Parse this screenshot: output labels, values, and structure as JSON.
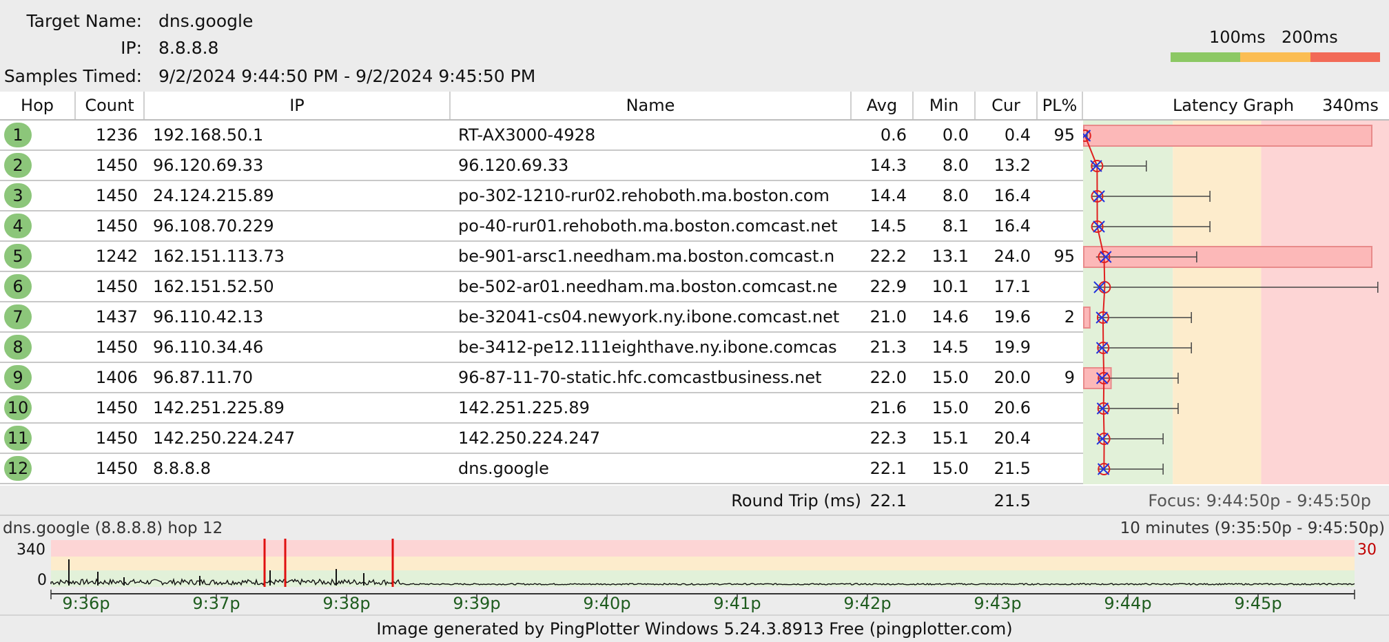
{
  "header": {
    "target_label": "Target Name:",
    "target_value": "dns.google",
    "ip_label": "IP:",
    "ip_value": "8.8.8.8",
    "samples_label": "Samples Timed:",
    "samples_value": "9/2/2024 9:44:50 PM - 9/2/2024 9:45:50 PM",
    "scale_100": "100ms",
    "scale_200": "200ms"
  },
  "colors": {
    "good": "#8cc864",
    "warn": "#fbbd53",
    "bad": "#f26a57",
    "zone_good": "#e2f1d9",
    "zone_warn": "#fdeccc",
    "zone_bad": "#fdd5d5",
    "hop_badge": "#8cc67a",
    "time_label": "#1e5c1e"
  },
  "columns": {
    "hop": "Hop",
    "count": "Count",
    "ip": "IP",
    "name": "Name",
    "avg": "Avg",
    "min": "Min",
    "cur": "Cur",
    "pl": "PL%",
    "graph": "Latency Graph",
    "graph_max": "340ms"
  },
  "hops": [
    {
      "hop": "1",
      "count": "1236",
      "ip": "192.168.50.1",
      "name": "RT-AX3000-4928",
      "avg": "0.6",
      "min": "0.0",
      "cur": "0.4",
      "pl": "95"
    },
    {
      "hop": "2",
      "count": "1450",
      "ip": "96.120.69.33",
      "name": "96.120.69.33",
      "avg": "14.3",
      "min": "8.0",
      "cur": "13.2",
      "pl": ""
    },
    {
      "hop": "3",
      "count": "1450",
      "ip": "24.124.215.89",
      "name": "po-302-1210-rur02.rehoboth.ma.boston.com",
      "avg": "14.4",
      "min": "8.0",
      "cur": "16.4",
      "pl": ""
    },
    {
      "hop": "4",
      "count": "1450",
      "ip": "96.108.70.229",
      "name": "po-40-rur01.rehoboth.ma.boston.comcast.net",
      "avg": "14.5",
      "min": "8.1",
      "cur": "16.4",
      "pl": ""
    },
    {
      "hop": "5",
      "count": "1242",
      "ip": "162.151.113.73",
      "name": "be-901-arsc1.needham.ma.boston.comcast.n",
      "avg": "22.2",
      "min": "13.1",
      "cur": "24.0",
      "pl": "95"
    },
    {
      "hop": "6",
      "count": "1450",
      "ip": "162.151.52.50",
      "name": "be-502-ar01.needham.ma.boston.comcast.ne",
      "avg": "22.9",
      "min": "10.1",
      "cur": "17.1",
      "pl": ""
    },
    {
      "hop": "7",
      "count": "1437",
      "ip": "96.110.42.13",
      "name": "be-32041-cs04.newyork.ny.ibone.comcast.net",
      "avg": "21.0",
      "min": "14.6",
      "cur": "19.6",
      "pl": "2"
    },
    {
      "hop": "8",
      "count": "1450",
      "ip": "96.110.34.46",
      "name": "be-3412-pe12.111eighthave.ny.ibone.comcas",
      "avg": "21.3",
      "min": "14.5",
      "cur": "19.9",
      "pl": ""
    },
    {
      "hop": "9",
      "count": "1406",
      "ip": "96.87.11.70",
      "name": "96-87-11-70-static.hfc.comcastbusiness.net",
      "avg": "22.0",
      "min": "15.0",
      "cur": "20.0",
      "pl": "9"
    },
    {
      "hop": "10",
      "count": "1450",
      "ip": "142.251.225.89",
      "name": "142.251.225.89",
      "avg": "21.6",
      "min": "15.0",
      "cur": "20.6",
      "pl": ""
    },
    {
      "hop": "11",
      "count": "1450",
      "ip": "142.250.224.247",
      "name": "142.250.224.247",
      "avg": "22.3",
      "min": "15.1",
      "cur": "20.4",
      "pl": ""
    },
    {
      "hop": "12",
      "count": "1450",
      "ip": "8.8.8.8",
      "name": "dns.google",
      "avg": "22.1",
      "min": "15.0",
      "cur": "21.5",
      "pl": ""
    }
  ],
  "graph": {
    "max_ms": 340,
    "zones_ms": [
      100,
      200
    ],
    "hops": [
      {
        "min": 0.0,
        "avg": 0.6,
        "cur": 0.4,
        "max": 3,
        "pl": 95
      },
      {
        "min": 8.0,
        "avg": 14.3,
        "cur": 13.2,
        "max": 70,
        "pl": 0
      },
      {
        "min": 8.0,
        "avg": 14.4,
        "cur": 16.4,
        "max": 142,
        "pl": 0
      },
      {
        "min": 8.1,
        "avg": 14.5,
        "cur": 16.4,
        "max": 142,
        "pl": 0
      },
      {
        "min": 13.1,
        "avg": 22.2,
        "cur": 24.0,
        "max": 127,
        "pl": 95
      },
      {
        "min": 10.1,
        "avg": 22.9,
        "cur": 17.1,
        "max": 332,
        "pl": 0
      },
      {
        "min": 14.6,
        "avg": 21.0,
        "cur": 19.6,
        "max": 121,
        "pl": 2
      },
      {
        "min": 14.5,
        "avg": 21.3,
        "cur": 19.9,
        "max": 121,
        "pl": 0
      },
      {
        "min": 15.0,
        "avg": 22.0,
        "cur": 20.0,
        "max": 106,
        "pl": 9
      },
      {
        "min": 15.0,
        "avg": 21.6,
        "cur": 20.6,
        "max": 106,
        "pl": 0
      },
      {
        "min": 15.1,
        "avg": 22.3,
        "cur": 20.4,
        "max": 89,
        "pl": 0
      },
      {
        "min": 15.0,
        "avg": 22.1,
        "cur": 21.5,
        "max": 89,
        "pl": 0
      }
    ]
  },
  "summary": {
    "label": "Round Trip (ms)",
    "avg": "22.1",
    "cur": "21.5",
    "focus": "Focus: 9:44:50p - 9:45:50p"
  },
  "timeline": {
    "title": "dns.google (8.8.8.8) hop 12",
    "range": "10 minutes (9:35:50p - 9:45:50p)",
    "y_max": "340",
    "y_min": "0",
    "pl_max": "30",
    "time_labels": [
      "9:36p",
      "9:37p",
      "9:38p",
      "9:39p",
      "9:40p",
      "9:41p",
      "9:42p",
      "9:43p",
      "9:44p",
      "9:45p"
    ]
  },
  "footer": "Image generated by PingPlotter Windows 5.24.3.8913 Free (pingplotter.com)"
}
